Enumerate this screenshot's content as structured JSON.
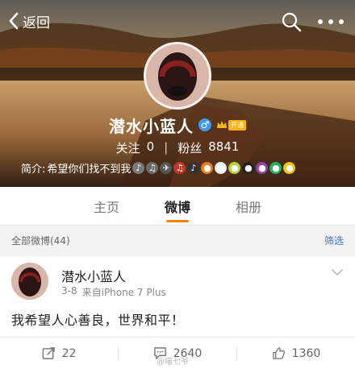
{
  "topbar": {
    "back_label": "返回",
    "back_icon": "chevron-left-icon",
    "search_icon": "search-icon",
    "more_icon": "more-dots-icon"
  },
  "profile": {
    "username": "潜水小蓝人",
    "gender_icon": "male-icon",
    "gender_glyph": "♂",
    "vip_badge": "开通",
    "following_label": "关注",
    "following_count": "0",
    "followers_label": "粉丝",
    "followers_count": "8841",
    "bio_prefix": "简介:",
    "bio_text": "希望你们找不到我",
    "bio_emojis": [
      "♪",
      "♫",
      "✈",
      "♫",
      "♪",
      "●",
      "●",
      "●",
      "●",
      "●",
      "●",
      "●",
      "●"
    ]
  },
  "tabs": [
    {
      "label": "主页",
      "active": false
    },
    {
      "label": "微博",
      "active": true
    },
    {
      "label": "相册",
      "active": false
    }
  ],
  "filter_bar": {
    "all_posts_label": "全部微博(44)",
    "filter_label": "筛选"
  },
  "post": {
    "author": "潜水小蓝人",
    "date": "3-8",
    "source": "来自iPhone 7 Plus",
    "text": "我希望人心善良，世界和平！",
    "reposts": "22",
    "comments": "2640",
    "likes": "1360"
  },
  "watermark": "@喵七爷",
  "colors": {
    "accent": "#ff8200",
    "link": "#3b75c5",
    "gender": "#3e9bf0",
    "vip": "#f6b21a"
  }
}
